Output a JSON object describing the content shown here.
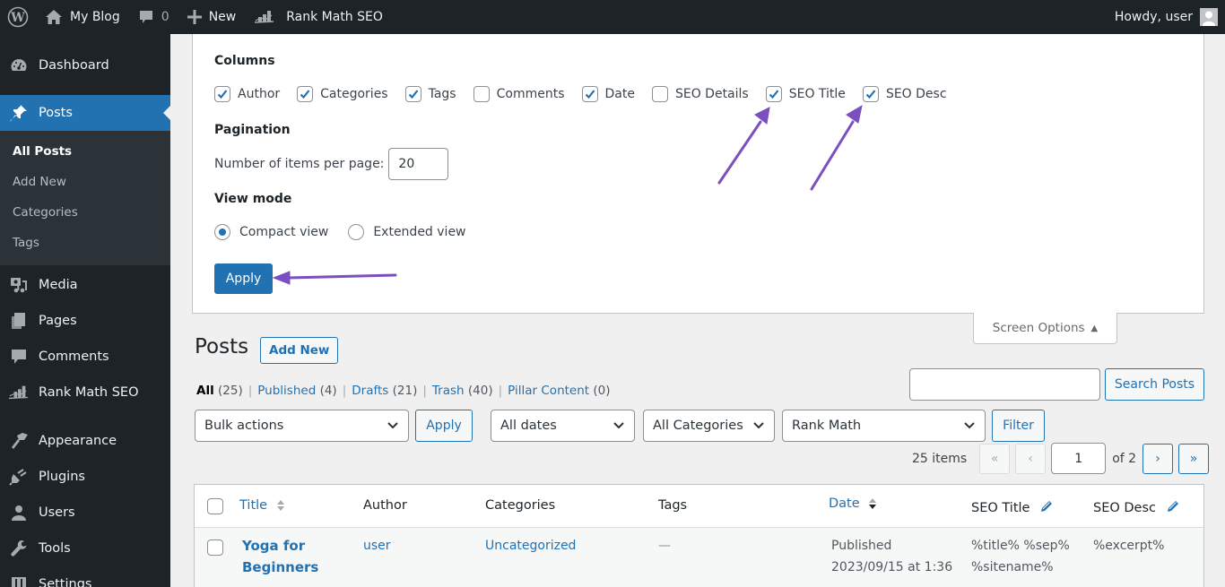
{
  "adminbar": {
    "site_name": "My Blog",
    "comments_count": "0",
    "new_label": "New",
    "plugin_label": "Rank Math SEO",
    "greeting": "Howdy, user"
  },
  "sidebar": {
    "items": [
      {
        "label": "Dashboard",
        "icon": "dashboard-icon"
      },
      {
        "label": "Posts",
        "icon": "pin-icon",
        "current": true
      },
      {
        "label": "Media",
        "icon": "media-icon"
      },
      {
        "label": "Pages",
        "icon": "pages-icon"
      },
      {
        "label": "Comments",
        "icon": "comments-icon"
      },
      {
        "label": "Rank Math SEO",
        "icon": "rank-math-icon"
      },
      {
        "label": "Appearance",
        "icon": "paintbrush-icon"
      },
      {
        "label": "Plugins",
        "icon": "plug-icon"
      },
      {
        "label": "Users",
        "icon": "user-icon"
      },
      {
        "label": "Tools",
        "icon": "wrench-icon"
      },
      {
        "label": "Settings",
        "icon": "settings-icon"
      }
    ],
    "posts_submenu": [
      {
        "label": "All Posts",
        "current": true
      },
      {
        "label": "Add New"
      },
      {
        "label": "Categories"
      },
      {
        "label": "Tags"
      }
    ]
  },
  "screen_options": {
    "columns_legend": "Columns",
    "columns": [
      {
        "label": "Author",
        "checked": true
      },
      {
        "label": "Categories",
        "checked": true
      },
      {
        "label": "Tags",
        "checked": true
      },
      {
        "label": "Comments",
        "checked": false
      },
      {
        "label": "Date",
        "checked": true
      },
      {
        "label": "SEO Details",
        "checked": false
      },
      {
        "label": "SEO Title",
        "checked": true
      },
      {
        "label": "SEO Desc",
        "checked": true
      }
    ],
    "pagination_legend": "Pagination",
    "per_page_label": "Number of items per page:",
    "per_page_value": "20",
    "view_mode_legend": "View mode",
    "view_modes": [
      {
        "label": "Compact view",
        "checked": true
      },
      {
        "label": "Extended view",
        "checked": false
      }
    ],
    "apply_label": "Apply",
    "toggle_label": "Screen Options"
  },
  "annotation_color": "#7b4fbf",
  "posts": {
    "title": "Posts",
    "add_new_label": "Add New",
    "filters": [
      {
        "label": "All",
        "count": "(25)",
        "current": true
      },
      {
        "label": "Published",
        "count": "(4)"
      },
      {
        "label": "Drafts",
        "count": "(21)"
      },
      {
        "label": "Trash",
        "count": "(40)"
      },
      {
        "label": "Pillar Content",
        "count": "(0)"
      }
    ],
    "search_value": "",
    "search_button": "Search Posts",
    "bulk_actions": "Bulk actions",
    "bulk_apply": "Apply",
    "dates_filter": "All dates",
    "categories_filter": "All Categories",
    "rank_math_filter": "Rank Math",
    "filter_button": "Filter",
    "items_count": "25 items",
    "first_page": "«",
    "prev_page": "‹",
    "current_page": "1",
    "of_pages": "of 2",
    "next_page": "›",
    "last_page": "»",
    "table": {
      "headers": [
        "Title",
        "Author",
        "Categories",
        "Tags",
        "Date",
        "SEO Title",
        "SEO Desc"
      ],
      "rows": [
        {
          "title_line1": "Yoga for",
          "title_line2": "Beginners",
          "author": "user",
          "categories": "Uncategorized",
          "tags": "—",
          "date_status": "Published",
          "date_value": "2023/09/15 at 1:36",
          "seo_title_line1": "%title% %sep%",
          "seo_title_line2": "%sitename%",
          "seo_desc": "%excerpt%"
        }
      ]
    }
  },
  "colors": {
    "admin_dark": "#1d2327",
    "accent_blue": "#2271b1",
    "submenu_bg": "#2c3338",
    "page_bg": "#f0f0f1"
  }
}
